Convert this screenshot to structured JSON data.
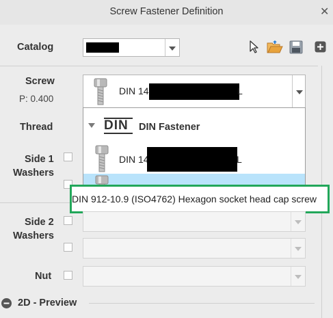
{
  "window": {
    "title": "Screw Fastener Definition"
  },
  "labels": {
    "catalog": "Catalog",
    "screw": "Screw",
    "pitch": "P: 0.400",
    "thread": "Thread",
    "side1_line1": "Side 1",
    "side1_line2": "Washers",
    "side2_line1": "Side 2",
    "side2_line2": "Washers",
    "nut": "Nut",
    "preview": "2D - Preview"
  },
  "screw_combo": {
    "value_prefix": "DIN 14",
    "value_suffix": "L"
  },
  "dropdown": {
    "group_label": "DIN Fastener",
    "group_logo": "DIN",
    "items": [
      {
        "prefix": "DIN 14",
        "suffix": "L"
      }
    ]
  },
  "tooltip": {
    "text": "DIN 912-10.9 (ISO4762) Hexagon socket head cap screw"
  },
  "icons": {
    "select": "cursor-arrow-icon",
    "open": "folder-open-icon",
    "save": "save-disk-icon",
    "add": "plus-square-icon",
    "collapse": "minus-circle-icon"
  },
  "colors": {
    "highlight": "#22a75a",
    "selected_row": "#b9e3fb",
    "folder": "#e8a33c"
  }
}
